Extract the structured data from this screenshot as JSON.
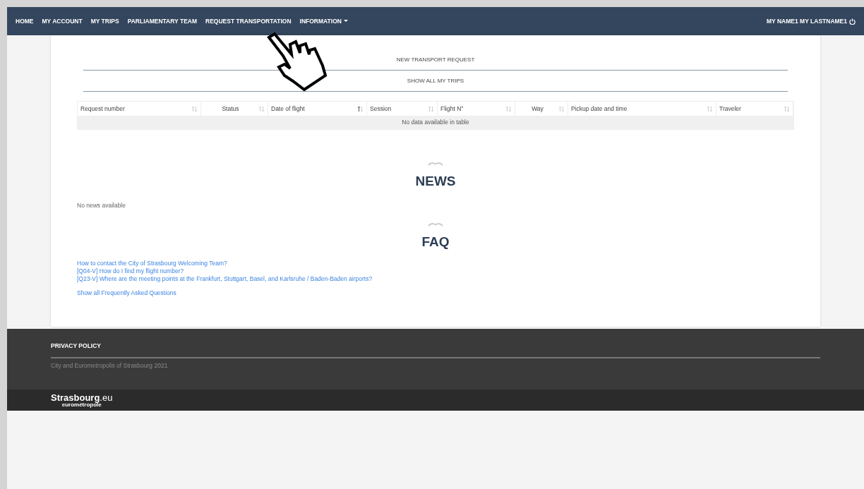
{
  "navbar": {
    "items": [
      {
        "label": "HOME",
        "dropdown": false
      },
      {
        "label": "MY ACCOUNT",
        "dropdown": false
      },
      {
        "label": "MY TRIPS",
        "dropdown": false
      },
      {
        "label": "PARLIAMENTARY TEAM",
        "dropdown": false
      },
      {
        "label": "REQUEST TRANSPORTATION",
        "dropdown": false
      },
      {
        "label": "INFORMATION",
        "dropdown": true
      }
    ],
    "user": "MY NAME1 MY LASTNAME1"
  },
  "actions": [
    "NEW TRANSPORT REQUEST",
    "SHOW ALL MY TRIPS"
  ],
  "table": {
    "columns": [
      {
        "label": "Request number",
        "sorted": false
      },
      {
        "label": "Status",
        "sorted": false
      },
      {
        "label": "Date of flight",
        "sorted": true
      },
      {
        "label": "Session",
        "sorted": false
      },
      {
        "label": "Flight N°",
        "sorted": false
      },
      {
        "label": "Way",
        "sorted": false
      },
      {
        "label": "Pickup date and time",
        "sorted": false
      },
      {
        "label": "Traveler",
        "sorted": false
      }
    ],
    "empty_message": "No data available in table"
  },
  "news": {
    "title": "NEWS",
    "message": "No news available"
  },
  "faq": {
    "title": "FAQ",
    "links": [
      "How to contact the City of Strasbourg Welcoming Team?",
      "[Q04-V] How do I find my flight number?",
      "[Q23-V] Where are the meeting points at the Frankfurt, Stuttgart, Basel, and Karlsruhe / Baden-Baden airports?"
    ],
    "show_all": "Show all Frequently Asked Questions"
  },
  "footer": {
    "link": "PRIVACY POLICY",
    "copyright": "City and Eurometropolis of Strasbourg 2021",
    "logo": {
      "main": "Strasbourg",
      "suffix": ".eu",
      "tagline": "eurométropole"
    }
  }
}
